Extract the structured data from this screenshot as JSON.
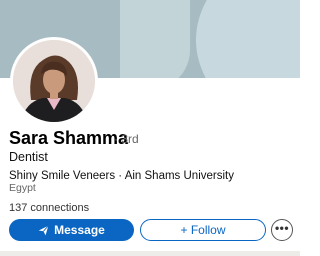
{
  "profile": {
    "name": "Sara Shamma",
    "degree": "· 3rd",
    "headline": "Dentist",
    "subline": "Shiny Smile Veneers · Ain Shams University",
    "location": "Egypt",
    "connections": "137 connections"
  },
  "actions": {
    "message_label": "Message",
    "follow_label": "+ Follow",
    "more_label": "•••"
  },
  "icons": {
    "message": "paper-plane-icon"
  },
  "colors": {
    "accent": "#0a66c2",
    "cover": "#a6bbc2"
  }
}
